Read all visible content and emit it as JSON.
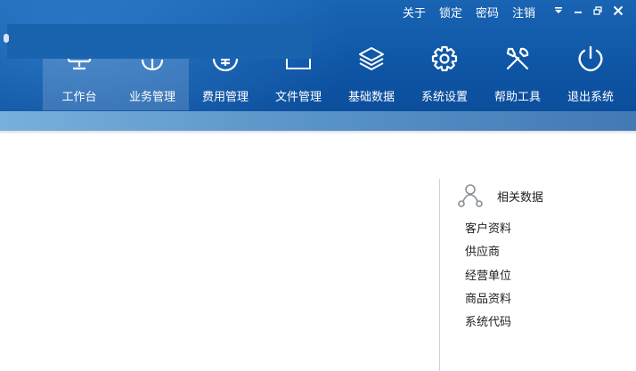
{
  "topbar": {
    "links": [
      "关于",
      "锁定",
      "密码",
      "注销"
    ],
    "window_controls": [
      "dropdown-icon",
      "minimize-icon",
      "restore-icon",
      "close-icon"
    ]
  },
  "nav": {
    "items": [
      {
        "label": "工作台",
        "icon": "monitor-icon",
        "active": true
      },
      {
        "label": "业务管理",
        "icon": "anchor-icon",
        "active": true
      },
      {
        "label": "费用管理",
        "icon": "yen-icon",
        "active": false
      },
      {
        "label": "文件管理",
        "icon": "folder-icon",
        "active": false
      },
      {
        "label": "基础数据",
        "icon": "layers-icon",
        "active": false
      },
      {
        "label": "系统设置",
        "icon": "gear-icon",
        "active": false
      },
      {
        "label": "帮助工具",
        "icon": "tools-icon",
        "active": false
      },
      {
        "label": "退出系统",
        "icon": "power-icon",
        "active": false
      }
    ]
  },
  "related": {
    "title": "相关数据",
    "icon": "share-nodes-icon",
    "items": [
      "客户资料",
      "供应商",
      "经营单位",
      "商品资料",
      "系统代码"
    ]
  },
  "colors": {
    "header": "#0f56a6",
    "subbar": "#5590c6",
    "accent_white": "#ffffff"
  }
}
